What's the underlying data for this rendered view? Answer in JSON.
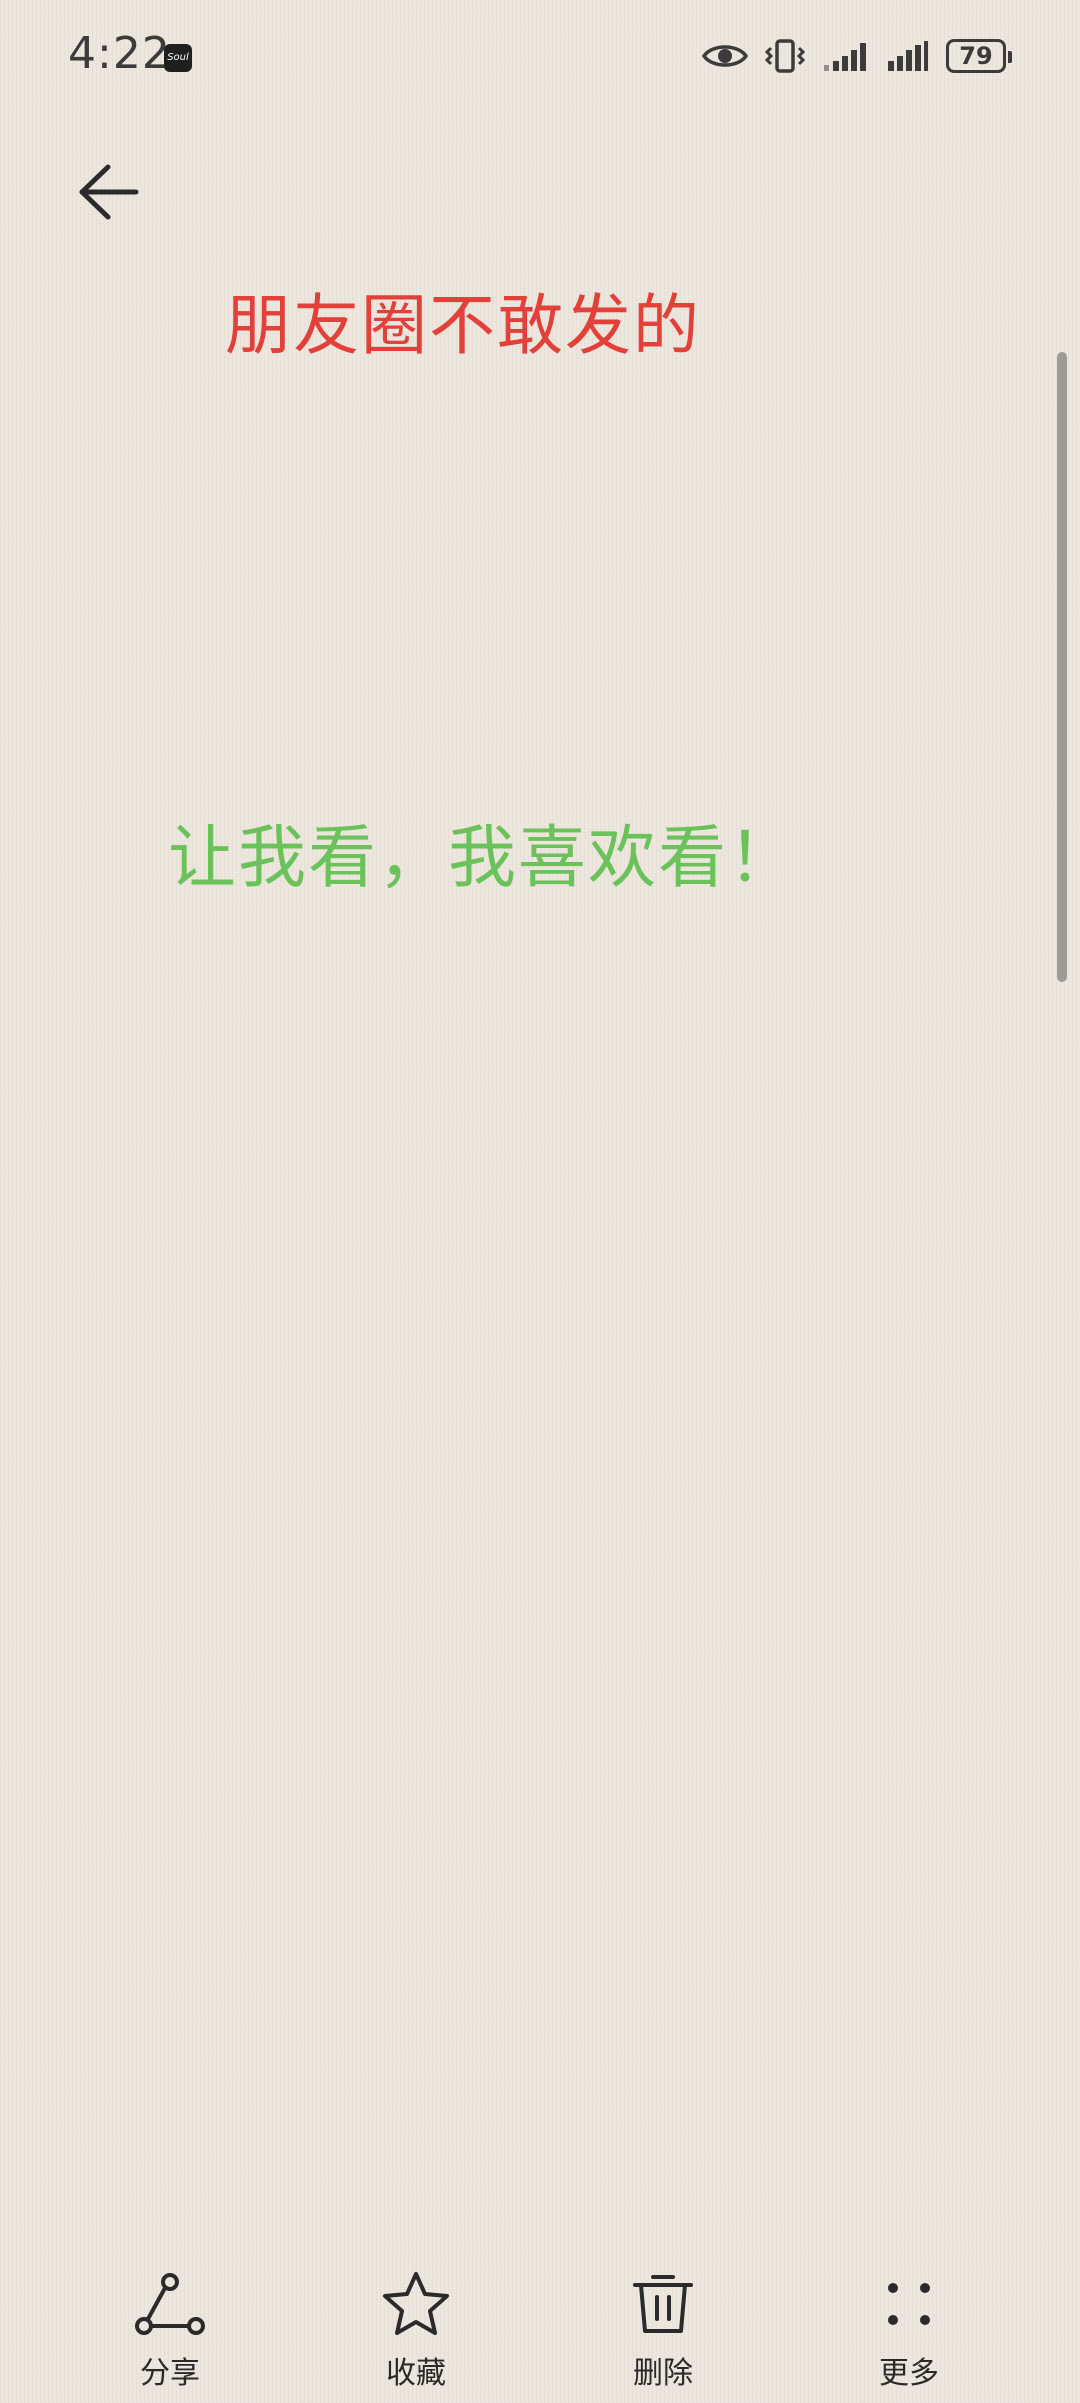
{
  "status_bar": {
    "time": "4:22",
    "app_badge_text": "Soul",
    "battery_level": "79",
    "icons": [
      "eye-icon",
      "vibrate-icon",
      "signal-bars-icon",
      "signal-bars-icon",
      "battery-icon"
    ]
  },
  "header": {
    "back_icon": "arrow-left-icon"
  },
  "note": {
    "title": "朋友圈不敢发的",
    "title_color": "#e3403a",
    "body": "让我看，我喜欢看！",
    "body_color": "#6cc25a"
  },
  "toolbar": {
    "items": [
      {
        "label": "分享",
        "icon": "share-icon"
      },
      {
        "label": "收藏",
        "icon": "star-icon"
      },
      {
        "label": "删除",
        "icon": "trash-icon"
      },
      {
        "label": "更多",
        "icon": "more-dots-icon"
      }
    ]
  }
}
